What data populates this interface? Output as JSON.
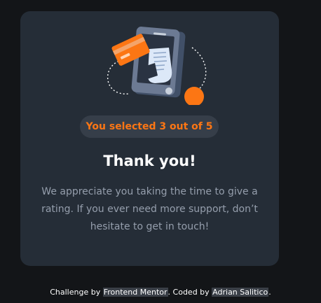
{
  "card": {
    "illustration_icon": "payment-receipt-illustration",
    "badge_text": "You selected 3 out of 5",
    "selected_rating": 3,
    "max_rating": 5,
    "title": "Thank you!",
    "message": "We appreciate you taking the time to give a rating. If you ever need more support, don’t hesitate to get in touch!"
  },
  "attribution": {
    "prefix": "Challenge by",
    "challenge_link": "Frontend Mentor",
    "middle": ". Coded by",
    "author_link": "Adrian Salitico",
    "suffix": "."
  },
  "colors": {
    "page_background": "#131518",
    "card_background": "#252d37",
    "accent_orange": "#fc7614",
    "badge_background": "#363e49",
    "title_white": "#ffffff",
    "body_text_gray": "#959eac"
  }
}
